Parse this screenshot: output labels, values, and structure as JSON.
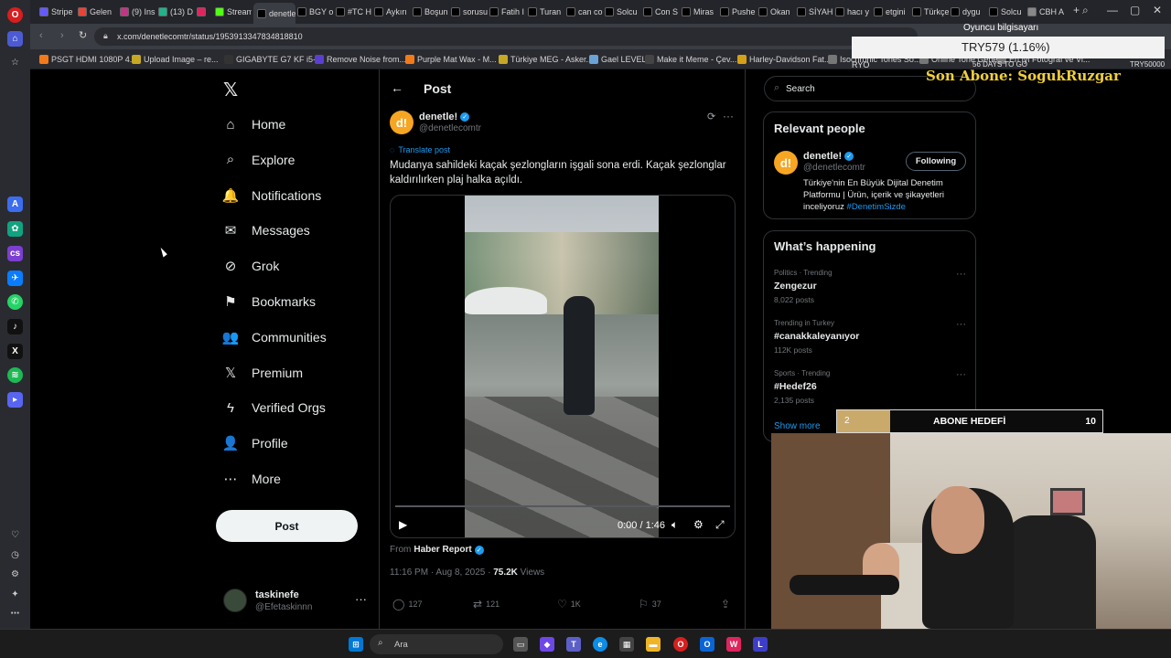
{
  "browser": {
    "tabs": [
      {
        "label": "Stripe",
        "icon": "stripe-icon",
        "color": "#635bff"
      },
      {
        "label": "Gelen",
        "icon": "gmail-icon",
        "color": "#ea4335"
      },
      {
        "label": "(9) Ins",
        "icon": "instagram-icon",
        "color": "#c13584"
      },
      {
        "label": "(13) D",
        "icon": "chat-icon",
        "color": "#20b38a"
      },
      {
        "label": "",
        "icon": "red-tab-icon",
        "color": "#e0245e"
      },
      {
        "label": "Stream",
        "icon": "kick-icon",
        "color": "#53fc18"
      },
      {
        "label": "denetle! or",
        "icon": "x-icon",
        "color": "#000000",
        "active": true
      },
      {
        "label": "BGY o",
        "icon": "x-icon",
        "color": "#000000"
      },
      {
        "label": "#TC H",
        "icon": "x-icon",
        "color": "#000000"
      },
      {
        "label": "Aykırı",
        "icon": "x-icon",
        "color": "#000000"
      },
      {
        "label": "Boşun",
        "icon": "x-icon",
        "color": "#000000"
      },
      {
        "label": "sorusu",
        "icon": "x-icon",
        "color": "#000000"
      },
      {
        "label": "Fatih I",
        "icon": "x-icon",
        "color": "#000000"
      },
      {
        "label": "Turan",
        "icon": "x-icon",
        "color": "#000000"
      },
      {
        "label": "can co",
        "icon": "x-icon",
        "color": "#000000"
      },
      {
        "label": "Solcu",
        "icon": "x-icon",
        "color": "#000000"
      },
      {
        "label": "Con S",
        "icon": "x-icon",
        "color": "#000000"
      },
      {
        "label": "Miras",
        "icon": "x-icon",
        "color": "#000000"
      },
      {
        "label": "Pushe",
        "icon": "x-icon",
        "color": "#000000"
      },
      {
        "label": "Okan",
        "icon": "x-icon",
        "color": "#000000"
      },
      {
        "label": "SİYAH",
        "icon": "x-icon",
        "color": "#000000"
      },
      {
        "label": "hacı y",
        "icon": "x-icon",
        "color": "#000000"
      },
      {
        "label": "etgini",
        "icon": "x-icon",
        "color": "#000000"
      },
      {
        "label": "Türkçe",
        "icon": "x-icon",
        "color": "#000000"
      },
      {
        "label": "dygu",
        "icon": "x-icon",
        "color": "#000000"
      },
      {
        "label": "Solcu",
        "icon": "x-icon",
        "color": "#000000"
      },
      {
        "label": "CBH A",
        "icon": "globe-icon",
        "color": "#888888"
      }
    ],
    "url": "x.com/denetlecomtr/status/1953913347834818810",
    "bookmarks": [
      {
        "label": "PSGT HDMI 1080P 4...",
        "icon": "hb-icon",
        "color": "#f27a1a"
      },
      {
        "label": "Upload Image – re...",
        "icon": "upload-icon",
        "color": "#c6a825"
      },
      {
        "label": "GIGABYTE G7 KF i5-...",
        "icon": "gigabyte-icon",
        "color": "#333333"
      },
      {
        "label": "Remove Noise from...",
        "icon": "m-icon",
        "color": "#5b3fd1"
      },
      {
        "label": "Purple Mat Wax - M...",
        "icon": "hb-icon",
        "color": "#f27a1a"
      },
      {
        "label": "Türkiye MEG - Asker...",
        "icon": "folder-icon",
        "color": "#c6a825"
      },
      {
        "label": "Gael LEVEL",
        "icon": "gael-icon",
        "color": "#6aa3d8"
      },
      {
        "label": "Make it Meme - Çev...",
        "icon": "meme-icon",
        "color": "#444444"
      },
      {
        "label": "Harley-Davidson Fat...",
        "icon": "s-icon",
        "color": "#d4a017"
      },
      {
        "label": "Isochronic Tones So...",
        "icon": "globe-icon",
        "color": "#777777"
      },
      {
        "label": "Online Tone Genera...",
        "icon": "globe-icon",
        "color": "#777777"
      },
      {
        "label": "En İyi Fotoğraf ve Vi...",
        "icon": "globe-icon",
        "color": "#777777"
      }
    ]
  },
  "nav": {
    "items": [
      {
        "label": "Home",
        "icon": "home-icon",
        "glyph": "⌂"
      },
      {
        "label": "Explore",
        "icon": "search-icon",
        "glyph": "⌕"
      },
      {
        "label": "Notifications",
        "icon": "bell-icon",
        "glyph": "🔔"
      },
      {
        "label": "Messages",
        "icon": "mail-icon",
        "glyph": "✉"
      },
      {
        "label": "Grok",
        "icon": "grok-icon",
        "glyph": "⊘"
      },
      {
        "label": "Bookmarks",
        "icon": "bookmark-icon",
        "glyph": "⚑"
      },
      {
        "label": "Communities",
        "icon": "people-icon",
        "glyph": "👥"
      },
      {
        "label": "Premium",
        "icon": "x-premium-icon",
        "glyph": "𝕏"
      },
      {
        "label": "Verified Orgs",
        "icon": "lightning-icon",
        "glyph": "ϟ"
      },
      {
        "label": "Profile",
        "icon": "person-icon",
        "glyph": "👤"
      },
      {
        "label": "More",
        "icon": "more-circle-icon",
        "glyph": "⋯"
      }
    ],
    "post_button": "Post",
    "account": {
      "name": "taskinefe",
      "handle": "@Efetaskinnn"
    }
  },
  "post": {
    "heading": "Post",
    "author_name": "denetle!",
    "author_handle": "@denetlecomtr",
    "avatar_text": "d!",
    "translate": "Translate post",
    "text": "Mudanya sahildeki kaçak şezlongların işgali sona erdi. Kaçak şezlonglar kaldırılırken plaj halka açıldı.",
    "video_time": "0:00 / 1:46",
    "video_progress": 0,
    "from_label": "From",
    "from_source": "Haber Report",
    "time": "11:16 PM · Aug 8, 2025 · ",
    "views_count": "75.2K",
    "views_label": " Views",
    "replies": "127",
    "reposts": "121",
    "likes": "1K",
    "bookmarks": "37"
  },
  "sidebar": {
    "search_placeholder": "Search",
    "relevant_title": "Relevant people",
    "person": {
      "name": "denetle!",
      "handle": "@denetlecomtr",
      "follow_label": "Following",
      "bio": "Türkiye'nin En Büyük Dijital Denetim Platformu | Ürün, içerik ve şikayetleri inceliyoruz ",
      "bio_tag": "#DenetimSizde"
    },
    "happening_title": "What’s happening",
    "trends": [
      {
        "context": "Politics · Trending",
        "name": "Zengezur",
        "count": "8,022 posts"
      },
      {
        "context": "Trending in Turkey",
        "name": "#canakkaleyanıyor",
        "count": "112K posts"
      },
      {
        "context": "Sports · Trending",
        "name": "#Hedef26",
        "count": "2,135 posts"
      }
    ],
    "show_more": "Show more"
  },
  "overlay": {
    "title": "Oyuncu bilgisayarı",
    "price": "TRY579 (1.16%)",
    "left_label": "RYO",
    "days": "56 DAYS TO GO",
    "right_label": "TRY50000",
    "subscriber": "Son Abone: SogukRuzgar",
    "goal_current": "2",
    "goal_label": "ABONE HEDEFİ",
    "goal_max": "10",
    "goal_fraction": 0.2
  },
  "taskbar": {
    "search_text": "Ara"
  }
}
